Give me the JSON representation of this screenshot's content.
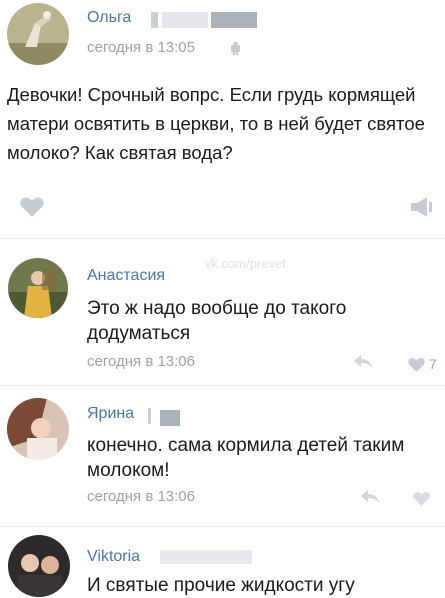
{
  "post": {
    "author": "Ольга",
    "time": "сегодня в 13:05",
    "text": "Девочки! Срочный вопрс. Если грудь кормящей матери освятить в церкви, то в ней будет святое молоко? Как святая вода?"
  },
  "watermark": "vk.com/prevet",
  "comments": [
    {
      "author": "Анастасия",
      "text": "Это ж надо вообще до такого додуматься",
      "time": "сегодня в 13:06",
      "likes": "7"
    },
    {
      "author": "Ярина",
      "text": "конечно. сама кормила детей таким молоком!",
      "time": "сегодня в 13:06"
    },
    {
      "author": "Viktoria",
      "text": "И святые прочие жидкости угу"
    }
  ],
  "colors": {
    "author": "#4a76a8",
    "meta": "#9aa3ad",
    "icon": "#c5ccd4"
  }
}
